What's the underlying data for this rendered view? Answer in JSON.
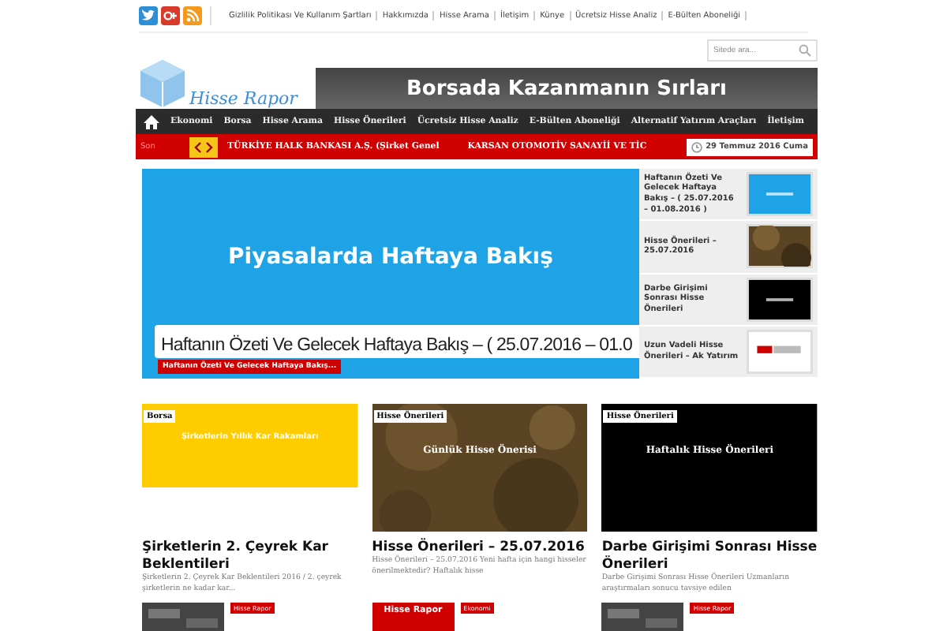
{
  "top_links": [
    "Gizlilik Politikası Ve Kullanım Şartları",
    "Hakkımızda",
    "Hisse Arama",
    "İletişim",
    "Künye",
    "Ücretsiz Hisse Analiz",
    "E-Bülten Aboneliği"
  ],
  "search": {
    "placeholder": "Sitede ara..."
  },
  "logo": {
    "text": "Hisse Rapor"
  },
  "banner": {
    "text": "Borsada Kazanmanın Sırları"
  },
  "nav": [
    "Ekonomi",
    "Borsa",
    "Hisse Arama",
    "Hisse Önerileri",
    "Ücretsiz Hisse Analiz",
    "E-Bülten Aboneliği",
    "Alternatif Yatırım Araçları",
    "İletişim"
  ],
  "ticker": {
    "label": "Son",
    "items": [
      "TÜRKİYE HALK BANKASI A.Ş. (Şirket Genel",
      "KARSAN OTOMOTİV SANAYİİ VE TİC"
    ],
    "date": "29 Temmuz 2016 Cuma"
  },
  "slider": {
    "image_text": "Piyasalarda Haftaya Bakış",
    "title": "Haftanın Özeti Ve Gelecek Haftaya Bakış – ( 25.07.2016 – 01.0",
    "badge": "Haftanın Özeti Ve Gelecek Haftaya Bakış..."
  },
  "slider_list": [
    {
      "title": "Haftanın Özeti Ve Gelecek Haftaya Bakış – ( 25.07.2016 – 01.08.2016 )"
    },
    {
      "title": "Hisse Önerileri – 25.07.2016"
    },
    {
      "title": "Darbe Girişimi Sonrası Hisse Önerileri"
    },
    {
      "title": "Uzun Vadeli Hisse Önerileri – Ak Yatırım"
    }
  ],
  "cards": [
    {
      "category": "Borsa",
      "image_text": "Şirketlerin Yıllık Kar Rakamları",
      "title": "Şirketlerin 2. Çeyrek Kar Beklentileri",
      "excerpt": "Şirketlerin 2. Çeyrek Kar Beklentileri 2016 / 2. çeyrek şirketlerin ne kadar kar..."
    },
    {
      "category": "Hisse Önerileri",
      "image_text": "Günlük Hisse Önerisi",
      "title": "Hisse Önerileri – 25.07.2016",
      "excerpt": "Hisse Önerileri – 25.07.2016 Yeni hafta için hangi hisseler önerilmektedir? Haftalık hisse"
    },
    {
      "category": "Hisse Önerileri",
      "image_text": "Haftalık Hisse Önerileri",
      "title": "Darbe Girişimi Sonrası Hisse Önerileri",
      "excerpt": "Darbe Girişimi Sonrası Hisse Önerileri Uzmanların araştırmaları sonucu tavsiye edilen"
    }
  ],
  "more": [
    {
      "category": "Hisse Rapor"
    },
    {
      "thumb_text": "Hisse Rapor",
      "category": "Ekonomi"
    },
    {
      "category": "Hisse Rapor"
    }
  ]
}
